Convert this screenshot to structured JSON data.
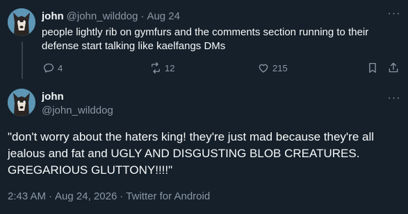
{
  "parent_tweet": {
    "name": "john",
    "handle": "@john_wilddog",
    "separator": "·",
    "date": "Aug 24",
    "text": "people lightly rib on gymfurs and the comments section running to their defense start talking like kaelfangs DMs",
    "more_label": "···",
    "replies": "4",
    "retweets": "12",
    "likes": "215"
  },
  "main_tweet": {
    "name": "john",
    "handle": "@john_wilddog",
    "more_label": "···",
    "text": "\"don't worry about the haters king! they're just mad because they're all jealous and fat and UGLY AND DISGUSTING BLOB CREATURES. GREGARIOUS GLUTTONY!!!!\"",
    "time": "2:43 AM",
    "sep1": "·",
    "date": "Aug 24, 2026",
    "sep2": "·",
    "source": "Twitter for Android"
  },
  "colors": {
    "background": "#15202b",
    "text": "#f7f9f9",
    "muted": "#8b98a5",
    "avatar_bg": "#5e96b5"
  }
}
